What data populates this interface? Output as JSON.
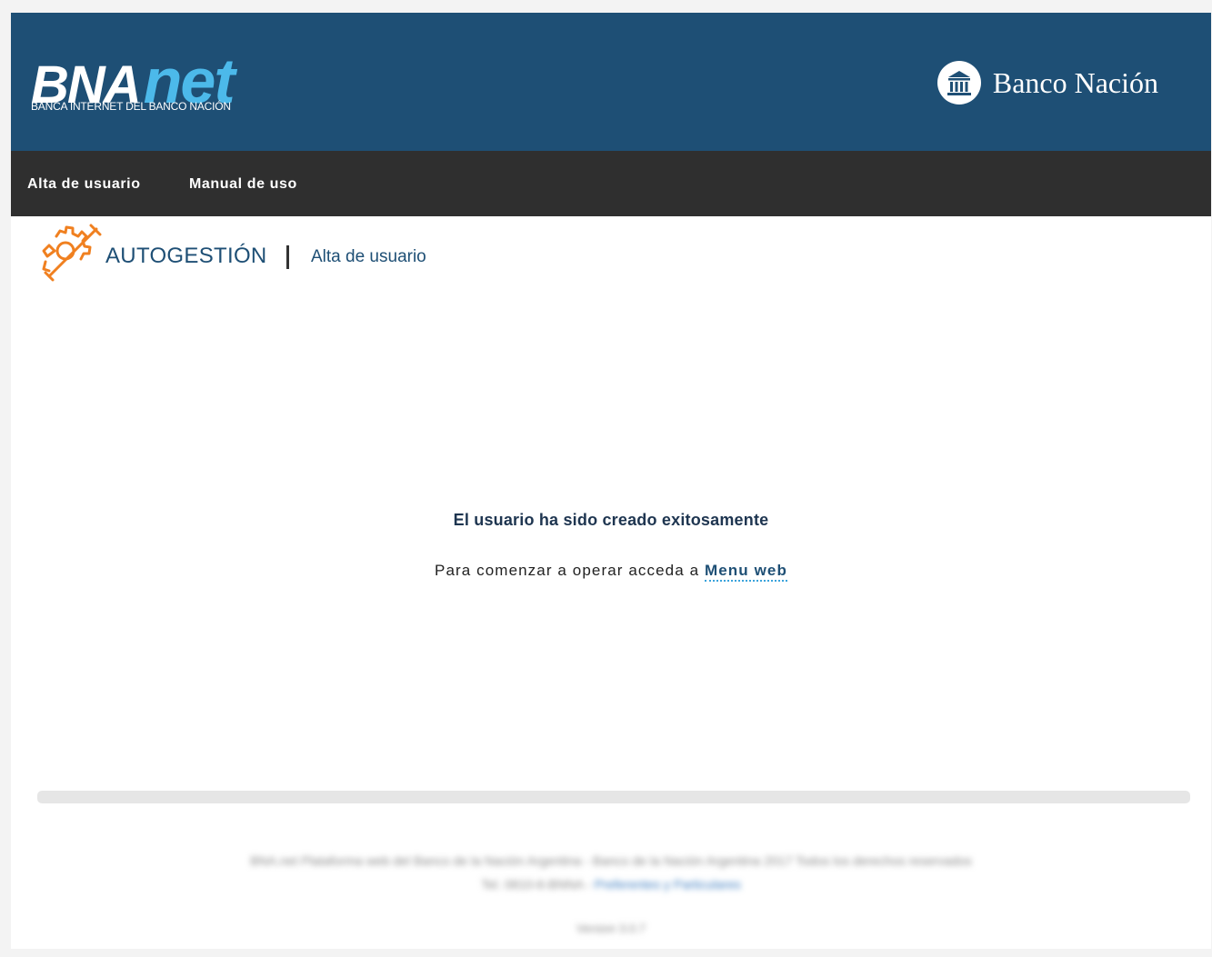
{
  "header": {
    "brand_bna": "BNA",
    "brand_net": "net",
    "brand_subtitle": "BANCA INTERNET DEL BANCO NACIÓN",
    "bank_name": "Banco Nación",
    "bank_icon": "bank-building-icon",
    "colors": {
      "background": "#1e4f75",
      "accent": "#4cb9ea"
    }
  },
  "nav": {
    "items": [
      {
        "label": "Alta de usuario"
      },
      {
        "label": "Manual de uso"
      }
    ],
    "background": "#2f2f2f"
  },
  "section": {
    "icon": "gear-wrench-icon",
    "title": "AUTOGESTIÓN",
    "subtitle": "Alta de usuario"
  },
  "main": {
    "success_message": "El usuario ha sido creado exitosamente",
    "instruction_prefix": "Para comenzar a operar acceda a ",
    "menu_link_label": "Menu web"
  },
  "footer": {
    "line1": "BNA.net Plataforma web del Banco de la Nación Argentina - Banco de la Nación Argentina 2017 Todos los derechos reservados",
    "line2_prefix": "Tel. 0810-6-BNNA - ",
    "line2_link": "Preferentes y Particulares",
    "version": "Version 3.0.7"
  }
}
